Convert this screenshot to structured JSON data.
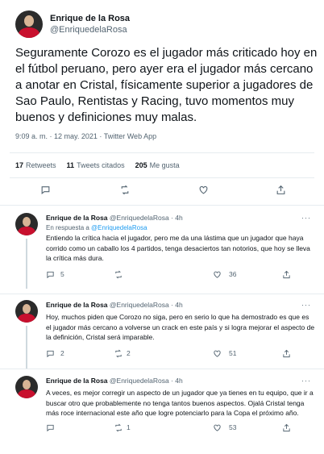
{
  "main": {
    "author_name": "Enrique de la Rosa",
    "author_handle": "@EnriquedelaRosa",
    "text": "Seguramente Corozo es el jugador más criticado hoy en el fútbol peruano, pero ayer era el jugador más cercano a anotar en Cristal, físicamente superior a jugadores de Sao Paulo, Rentistas y Racing, tuvo momentos muy buenos y definiciones muy malas.",
    "meta": "9:09 a. m. · 12 may. 2021 · Twitter Web App",
    "stats": {
      "retweets_count": "17",
      "retweets_label": "Retweets",
      "quotes_count": "11",
      "quotes_label": "Tweets citados",
      "likes_count": "205",
      "likes_label": "Me gusta"
    }
  },
  "replies": [
    {
      "name": "Enrique de la Rosa",
      "handle_time": "@EnriquedelaRosa · 4h",
      "replying_prefix": "En respuesta a",
      "replying_to": "@EnriquedelaRosa",
      "text": "Entiendo la crítica hacia el jugador, pero me da una lástima que un jugador que haya corrido como un caballo los 4 partidos, tenga desaciertos tan notorios, que hoy se lleva la crítica más dura.",
      "reply_count": "5",
      "retweet_count": "",
      "like_count": "36"
    },
    {
      "name": "Enrique de la Rosa",
      "handle_time": "@EnriquedelaRosa · 4h",
      "text": "Hoy, muchos piden que Corozo no siga, pero en serio lo que ha demostrado es que es el jugador más cercano a volverse un crack en este país y si logra mejorar el aspecto de la definición, Cristal será imparable.",
      "reply_count": "2",
      "retweet_count": "2",
      "like_count": "51"
    },
    {
      "name": "Enrique de la Rosa",
      "handle_time": "@EnriquedelaRosa · 4h",
      "text": "A veces, es mejor corregir un aspecto de un jugador que ya tienes en tu equipo, que ir a buscar otro que probablemente no tenga tantos buenos aspectos. Ojalá Cristal tenga más roce internacional este año que logre potenciarlo para la Copa el próximo año.",
      "reply_count": "",
      "retweet_count": "1",
      "like_count": "53"
    }
  ],
  "icons": {
    "reply": "reply-icon",
    "retweet": "retweet-icon",
    "like": "heart-icon",
    "share": "share-icon",
    "more": "more-icon"
  },
  "colors": {
    "link": "#1d9bf0",
    "secondary": "#536471",
    "divider": "#e6ecf0"
  }
}
